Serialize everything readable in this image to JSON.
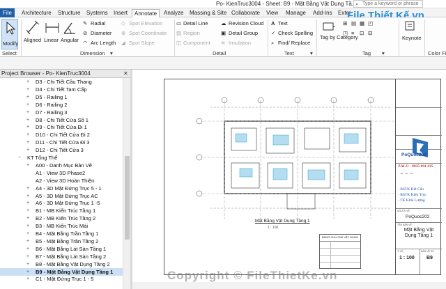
{
  "window": {
    "title": "Po- KienTruc3004 - Sheet: B9 - Mặt Bằng Vật Dụng Tầ...",
    "search_placeholder": "Type a keyword or phrase"
  },
  "tabs": [
    {
      "label": "File"
    },
    {
      "label": "Architecture"
    },
    {
      "label": "Structure"
    },
    {
      "label": "Systems"
    },
    {
      "label": "Insert"
    },
    {
      "label": "Annotate"
    },
    {
      "label": "Analyze"
    },
    {
      "label": "Massing & Site"
    },
    {
      "label": "Collaborate"
    },
    {
      "label": "View"
    },
    {
      "label": "Manage"
    },
    {
      "label": "Add-Ins"
    },
    {
      "label": "Exter"
    }
  ],
  "ribbon": {
    "modify": "Modify",
    "select": "Select",
    "dimension": {
      "aligned": "Aligned",
      "linear": "Linear",
      "angular": "Angular",
      "radial": "Radial",
      "diameter": "Diameter",
      "arc_length": "Arc Length",
      "spot_elevation": "Spot Elevation",
      "spot_coordinate": "Spot Coordinate",
      "spot_slope": "Spot Slope",
      "label": "Dimension"
    },
    "detail": {
      "detail_line": "Detail Line",
      "region": "Region",
      "component": "Component",
      "revision_cloud": "Revision Cloud",
      "detail_group": "Detail Group",
      "insulation": "Insulation",
      "label": "Detail"
    },
    "text": {
      "text": "Text",
      "check_spelling": "Check Spelling",
      "find_replace": "Find/ Replace",
      "label": "Text"
    },
    "tag": {
      "tag_by_category": "Tag by Category",
      "tag_label": "Tag"
    },
    "keynote": "Keynote",
    "color_fill": "Color Fi"
  },
  "project_browser": {
    "title": "Project Browser - Po- KienTruc3004",
    "items": [
      {
        "label": "D3 - Chi Tiết Cầu Thang",
        "indent": 2,
        "toggle": "+"
      },
      {
        "label": "D4 - Chi Tiết Tam Cấp",
        "indent": 2,
        "toggle": "+"
      },
      {
        "label": "D5 - Railing 1",
        "indent": 2,
        "toggle": "+"
      },
      {
        "label": "D6 - Railing 2",
        "indent": 2,
        "toggle": "+"
      },
      {
        "label": "D7 - Railing 3",
        "indent": 2,
        "toggle": "+"
      },
      {
        "label": "D8 - Chi Tiết Cửa Sổ 1",
        "indent": 2,
        "toggle": "+"
      },
      {
        "label": "D9 - Chi Tiết Cửa Đi 1",
        "indent": 2,
        "toggle": "+"
      },
      {
        "label": "D10 - Chi Tiết Cửa Đi 2",
        "indent": 2,
        "toggle": "+"
      },
      {
        "label": "D11 - Chi Tiết Cửa Đi 3",
        "indent": 2,
        "toggle": "+"
      },
      {
        "label": "D12 - Chi Tiết Cửa 3",
        "indent": 2,
        "toggle": "+"
      },
      {
        "label": "KT Tổng Thể",
        "indent": 1,
        "toggle": "−"
      },
      {
        "label": "A00 - Danh Mục Bản Vẽ",
        "indent": 2,
        "toggle": "+"
      },
      {
        "label": "A1 - View 3D Phase2",
        "indent": 2,
        "toggle": ""
      },
      {
        "label": "A2 - View 3D Hoàn Thiện",
        "indent": 2,
        "toggle": ""
      },
      {
        "label": "A4 - 3D Mặt Đứng Trục 5 - 1",
        "indent": 2,
        "toggle": "+"
      },
      {
        "label": "A5 - 3D Mặt Đứng Trục AC",
        "indent": 2,
        "toggle": "+"
      },
      {
        "label": "A6 - 3D Mặt Đứng Trục 1 -5",
        "indent": 2,
        "toggle": "+"
      },
      {
        "label": "B1 - MB Kiến Trúc Tầng 1",
        "indent": 2,
        "toggle": "+"
      },
      {
        "label": "B2 - MB Kiến Trúc Tầng 2",
        "indent": 2,
        "toggle": "+"
      },
      {
        "label": "B3 - MB Kiến Trúc Mái",
        "indent": 2,
        "toggle": "+"
      },
      {
        "label": "B4 - Mặt Bằng Trần Tầng 1",
        "indent": 2,
        "toggle": "+"
      },
      {
        "label": "B5 - Mặt Bằng Trần Tầng 2",
        "indent": 2,
        "toggle": "+"
      },
      {
        "label": "B6 - Mặt Bằng Lát Sàn Tầng 1",
        "indent": 2,
        "toggle": "+"
      },
      {
        "label": "B7 - Mặt Bằng Lát Sàn Tầng 2",
        "indent": 2,
        "toggle": "+"
      },
      {
        "label": "B8 - Mặt Bằng Vật Dụng Tầng 2",
        "indent": 2,
        "toggle": "+"
      },
      {
        "label": "B9 - Mặt Bằng Vật Dụng Tầng 1",
        "indent": 2,
        "toggle": "+",
        "selected": true
      },
      {
        "label": "C1 - Mặt Đứng Trục 1 - 5",
        "indent": 2,
        "toggle": "+"
      }
    ]
  },
  "sheet": {
    "drawing_title": "Mặt Bằng Vật Dụng Tầng 1",
    "scale_note": "1 : 100",
    "legend_title": "BẢNG CHÚ GIẢI VẬT DỤNG",
    "title_block": {
      "logo_text": "PoQuoc202",
      "phone": "ZALO - 0935 091 435",
      "notes": [
        "- BSTK Kết Cấu",
        "- BSTK Kiến Trúc",
        "- TK Khái Lượng"
      ],
      "owner_label": "NGƯỜI VẼ",
      "owner": "PoQuoc202",
      "sheet_name_label": "TÊN BẢN VẼ",
      "sheet_name": "Mặt Bằng Vật Dụng Tầng 1",
      "scale_label": "TỈ LỆ",
      "scale": "1 : 100",
      "sheet_no_label": "BẢN VẼ SỐ",
      "sheet_no": "B9"
    }
  },
  "watermark": {
    "top": "File Thiết Kế.vn",
    "bottom": "Copyright © FileThietKe.vn"
  },
  "colors": {
    "file_tab": "#1e5fa8",
    "selection": "#cce0f5",
    "accent": "#2a8fd6"
  }
}
